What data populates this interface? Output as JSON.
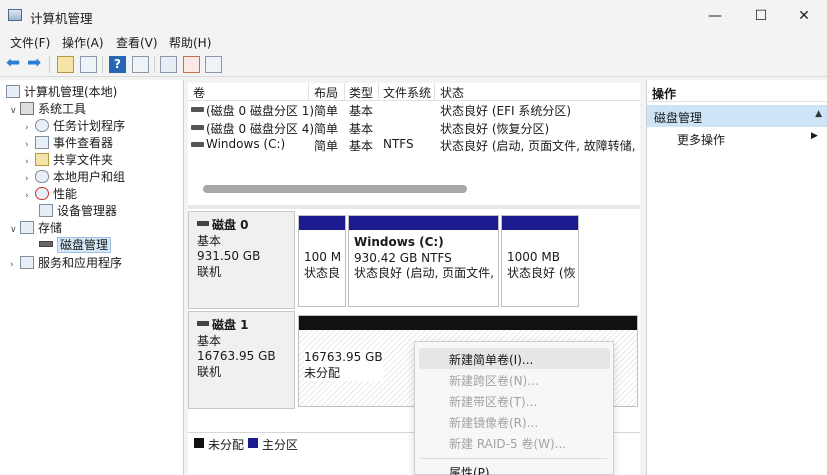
{
  "window": {
    "title": "计算机管理",
    "minimize_glyph": "—",
    "maximize_glyph": "☐",
    "close_glyph": "✕"
  },
  "menu": [
    "文件(F)",
    "操作(A)",
    "查看(V)",
    "帮助(H)"
  ],
  "toolbar": {
    "icons": [
      "back-icon",
      "forward-icon",
      "up-folder-icon",
      "show-hide-tree-icon",
      "help-icon",
      "properties-icon",
      "export-icon",
      "check-icon",
      "list-icon"
    ],
    "back_glyph": "⬅",
    "forward_glyph": "➡",
    "help_glyph": "?"
  },
  "tree": {
    "root": "计算机管理(本地)",
    "items": [
      {
        "label": "系统工具",
        "level": 1,
        "expanded": true
      },
      {
        "label": "任务计划程序",
        "level": 2,
        "expanded": false
      },
      {
        "label": "事件查看器",
        "level": 2,
        "expanded": false
      },
      {
        "label": "共享文件夹",
        "level": 2,
        "expanded": false
      },
      {
        "label": "本地用户和组",
        "level": 2,
        "expanded": false
      },
      {
        "label": "性能",
        "level": 2,
        "expanded": false
      },
      {
        "label": "设备管理器",
        "level": 2,
        "expanded": null
      },
      {
        "label": "存储",
        "level": 1,
        "expanded": true
      },
      {
        "label": "磁盘管理",
        "level": 2,
        "expanded": null,
        "selected": true
      },
      {
        "label": "服务和应用程序",
        "level": 1,
        "expanded": false
      }
    ]
  },
  "volumes": {
    "columns": [
      "卷",
      "布局",
      "类型",
      "文件系统",
      "状态"
    ],
    "rows": [
      {
        "volume": "(磁盘 0 磁盘分区 1)",
        "layout": "简单",
        "type": "基本",
        "fs": "",
        "status": "状态良好 (EFI 系统分区)"
      },
      {
        "volume": "(磁盘 0 磁盘分区 4)",
        "layout": "简单",
        "type": "基本",
        "fs": "",
        "status": "状态良好 (恢复分区)"
      },
      {
        "volume": "Windows (C:)",
        "layout": "简单",
        "type": "基本",
        "fs": "NTFS",
        "status": "状态良好 (启动, 页面文件, 故障转储, 基本"
      }
    ]
  },
  "disks": [
    {
      "name": "磁盘 0",
      "type": "基本",
      "size": "931.50 GB",
      "state": "联机",
      "partitions": [
        {
          "line1": "100 M",
          "line2": "状态良"
        },
        {
          "title": "Windows  (C:)",
          "line1": "930.42 GB NTFS",
          "line2": "状态良好 (启动, 页面文件, 故"
        },
        {
          "line1": "1000 MB",
          "line2": "状态良好 (恢"
        }
      ]
    },
    {
      "name": "磁盘 1",
      "type": "基本",
      "size": "16763.95 GB",
      "state": "联机",
      "partitions": [
        {
          "line1": "16763.95 GB",
          "line2": "未分配"
        }
      ]
    }
  ],
  "legend": [
    {
      "label": "未分配",
      "color": "#111111"
    },
    {
      "label": "主分区",
      "color": "#1b1b8f"
    }
  ],
  "context_menu": {
    "items": [
      {
        "label": "新建简单卷(I)...",
        "enabled": true,
        "highlighted": true
      },
      {
        "label": "新建跨区卷(N)...",
        "enabled": false
      },
      {
        "label": "新建带区卷(T)...",
        "enabled": false
      },
      {
        "label": "新建镜像卷(R)...",
        "enabled": false
      },
      {
        "label": "新建 RAID-5 卷(W)...",
        "enabled": false
      },
      {
        "label": "属性(P)",
        "enabled": true
      }
    ]
  },
  "actions": {
    "header": "操作",
    "section": "磁盘管理",
    "more": "更多操作",
    "section_glyph": "▲",
    "more_glyph": "▶"
  },
  "tree_glyphs": {
    "expanded": "∨",
    "collapsed": "›"
  }
}
